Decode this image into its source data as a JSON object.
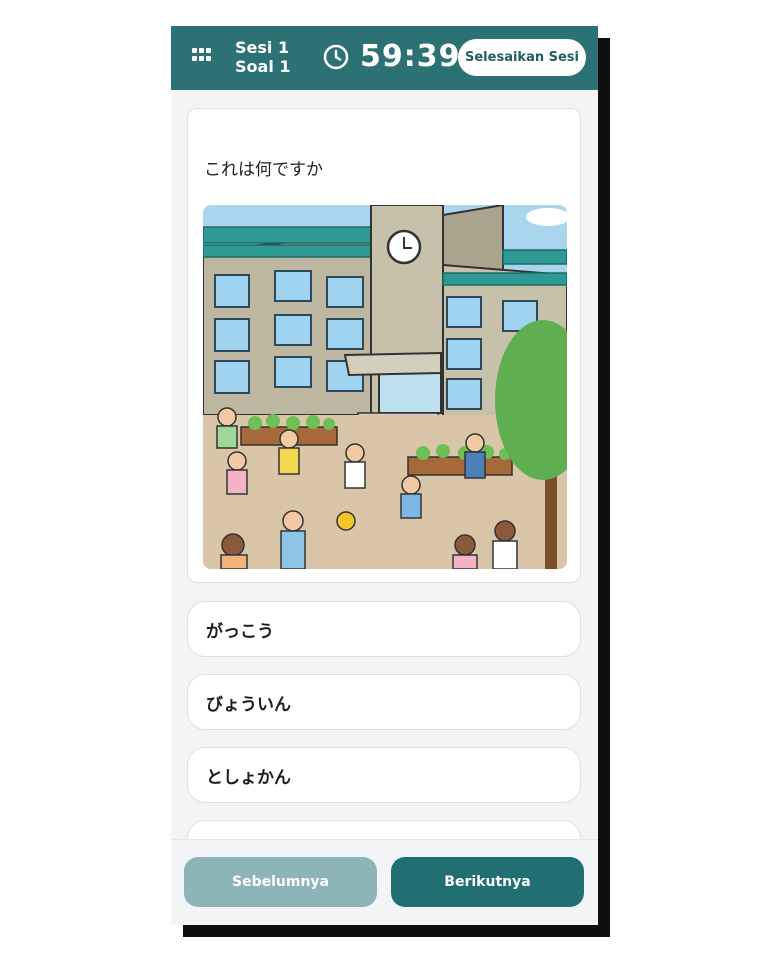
{
  "header": {
    "menu_icon": "grid-icon",
    "session_label": "Sesi 1",
    "question_label": "Soal 1",
    "timer_icon": "clock-icon",
    "timer": "59:39",
    "finish_button": "Selesaikan Sesi",
    "accent_color": "#2c7275"
  },
  "question": {
    "text": "これは何ですか",
    "image": "school-playground-illustration"
  },
  "options": [
    {
      "label": "がっこう"
    },
    {
      "label": "びょういん"
    },
    {
      "label": "としょかん"
    },
    {
      "label": ""
    }
  ],
  "navigation": {
    "prev_label": "Sebelumnya",
    "next_label": "Berikutnya"
  }
}
